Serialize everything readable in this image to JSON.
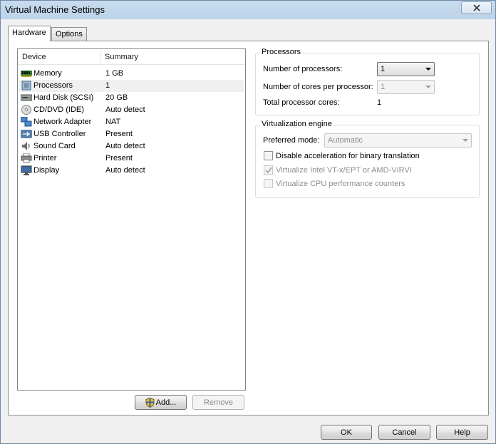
{
  "window": {
    "title": "Virtual Machine Settings"
  },
  "tabs": [
    {
      "label": "Hardware",
      "active": true
    },
    {
      "label": "Options",
      "active": false
    }
  ],
  "device_list": {
    "columns": [
      "Device",
      "Summary"
    ],
    "rows": [
      {
        "device": "Memory",
        "summary": "1 GB",
        "icon": "memory-icon"
      },
      {
        "device": "Processors",
        "summary": "1",
        "icon": "processor-icon",
        "selected": true
      },
      {
        "device": "Hard Disk (SCSI)",
        "summary": "20 GB",
        "icon": "hard-disk-icon"
      },
      {
        "device": "CD/DVD (IDE)",
        "summary": "Auto detect",
        "icon": "cd-dvd-icon"
      },
      {
        "device": "Network Adapter",
        "summary": "NAT",
        "icon": "network-adapter-icon"
      },
      {
        "device": "USB Controller",
        "summary": "Present",
        "icon": "usb-icon"
      },
      {
        "device": "Sound Card",
        "summary": "Auto detect",
        "icon": "sound-card-icon"
      },
      {
        "device": "Printer",
        "summary": "Present",
        "icon": "printer-icon"
      },
      {
        "device": "Display",
        "summary": "Auto detect",
        "icon": "display-icon"
      }
    ],
    "add_label": "Add...",
    "remove_label": "Remove"
  },
  "processors": {
    "legend": "Processors",
    "num_processors_label": "Number of processors:",
    "num_processors_value": "1",
    "cores_label": "Number of cores per processor:",
    "cores_value": "1",
    "total_label": "Total processor cores:",
    "total_value": "1"
  },
  "virtualization": {
    "legend": "Virtualization engine",
    "preferred_mode_label": "Preferred mode:",
    "preferred_mode_value": "Automatic",
    "options": [
      {
        "label": "Disable acceleration for binary translation",
        "checked": false,
        "enabled": true
      },
      {
        "label": "Virtualize Intel VT-x/EPT or AMD-V/RVI",
        "checked": true,
        "enabled": false
      },
      {
        "label": "Virtualize CPU performance counters",
        "checked": false,
        "enabled": false
      }
    ]
  },
  "footer": {
    "ok_label": "OK",
    "cancel_label": "Cancel",
    "help_label": "Help"
  }
}
